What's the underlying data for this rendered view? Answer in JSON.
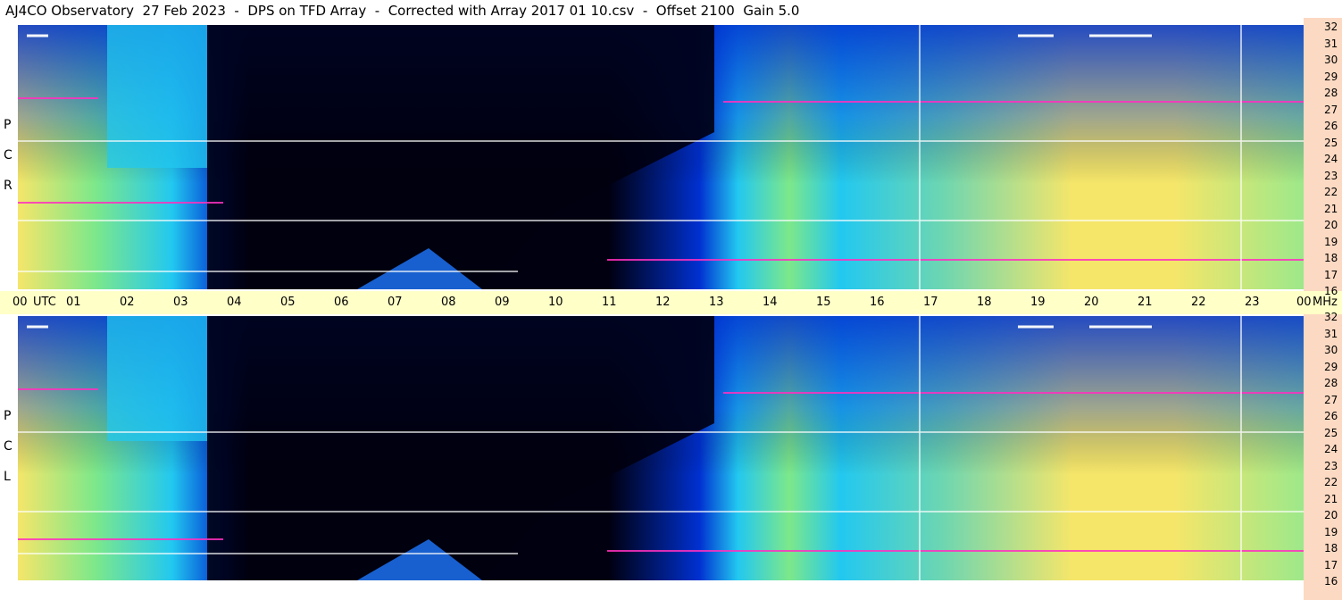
{
  "title": "AJ4CO Observatory  27 Feb 2023  -  DPS on TFD Array  -  Corrected with Array 2017 01 10.csv  -  Offset 2100  Gain 5.0",
  "panels": [
    {
      "name": "RCP",
      "letters": [
        "R",
        "C",
        "P"
      ]
    },
    {
      "name": "LCP",
      "letters": [
        "L",
        "C",
        "P"
      ]
    }
  ],
  "time_axis": {
    "labels": [
      "00",
      "UTC",
      "01",
      "02",
      "03",
      "04",
      "05",
      "06",
      "07",
      "08",
      "09",
      "10",
      "11",
      "12",
      "13",
      "14",
      "15",
      "16",
      "17",
      "18",
      "19",
      "20",
      "21",
      "22",
      "23",
      "00",
      "MHz"
    ]
  },
  "freq_axis": {
    "labels": [
      "32",
      "31",
      "30",
      "29",
      "28",
      "27",
      "26",
      "25",
      "24",
      "23",
      "22",
      "21",
      "20",
      "19",
      "18",
      "17",
      "16"
    ]
  },
  "colors": {
    "axis_strip": "#ffffc8",
    "right_axis": "#fcd9c2",
    "background_low": "#000010",
    "deep_blue": "#0030d0",
    "mid_blue": "#1e78ff",
    "cyan": "#22c8f0",
    "green": "#7de88a",
    "yellow": "#f5e66a",
    "orange": "#f5b060",
    "magenta": "#ff30c0"
  },
  "chart_data": {
    "type": "heatmap",
    "title": "AJ4CO Observatory  27 Feb 2023  -  DPS on TFD Array  -  Corrected with Array 2017 01 10.csv  -  Offset 2100  Gain 5.0",
    "x_range_utc_hours": [
      0,
      24
    ],
    "y_range_mhz": [
      16,
      32
    ],
    "x_ticks": [
      "00",
      "01",
      "02",
      "03",
      "04",
      "05",
      "06",
      "07",
      "08",
      "09",
      "10",
      "11",
      "12",
      "13",
      "14",
      "15",
      "16",
      "17",
      "18",
      "19",
      "20",
      "21",
      "22",
      "23",
      "00"
    ],
    "y_ticks": [
      32,
      31,
      30,
      29,
      28,
      27,
      26,
      25,
      24,
      23,
      22,
      21,
      20,
      19,
      18,
      17,
      16
    ],
    "series": [
      {
        "name": "RCP"
      },
      {
        "name": "LCP"
      }
    ]
  }
}
